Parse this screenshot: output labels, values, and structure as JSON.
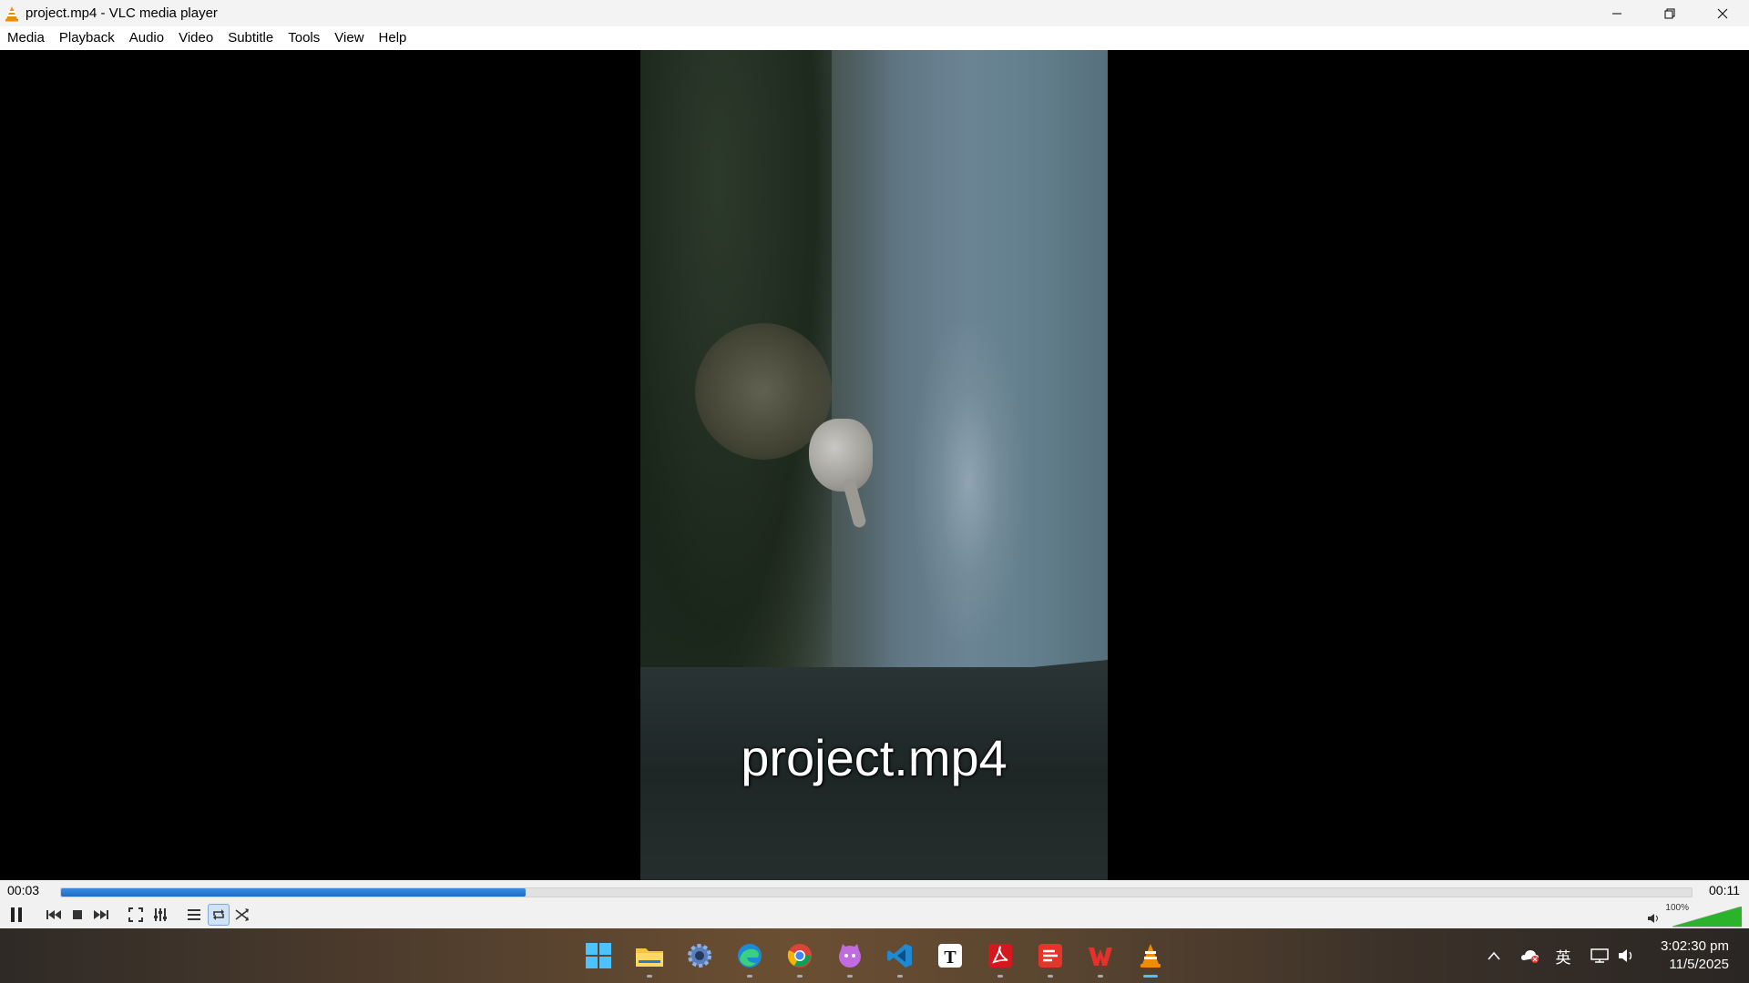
{
  "window": {
    "title": "project.mp4 - VLC media player"
  },
  "menu": {
    "items": [
      "Media",
      "Playback",
      "Audio",
      "Video",
      "Subtitle",
      "Tools",
      "View",
      "Help"
    ]
  },
  "video": {
    "overlay_title": "project.mp4"
  },
  "player": {
    "elapsed": "00:03",
    "total": "00:11",
    "progress_fraction": 0.285,
    "volume_label": "100%",
    "volume_fraction": 1.0,
    "loop_active": true
  },
  "taskbar": {
    "apps": [
      "windows-start",
      "file-explorer",
      "settings",
      "edge",
      "chrome",
      "cat-app",
      "vs-code",
      "typora",
      "acrobat",
      "pdf-app",
      "wps-office",
      "vlc"
    ],
    "active_app": "vlc"
  },
  "tray": {
    "ime": "英",
    "time": "3:02:30 pm",
    "date": "11/5/2025"
  },
  "colors": {
    "seek_fill": "#1d6bc6",
    "accent": "#4cc2ff",
    "vlc_orange": "#f08c00"
  }
}
